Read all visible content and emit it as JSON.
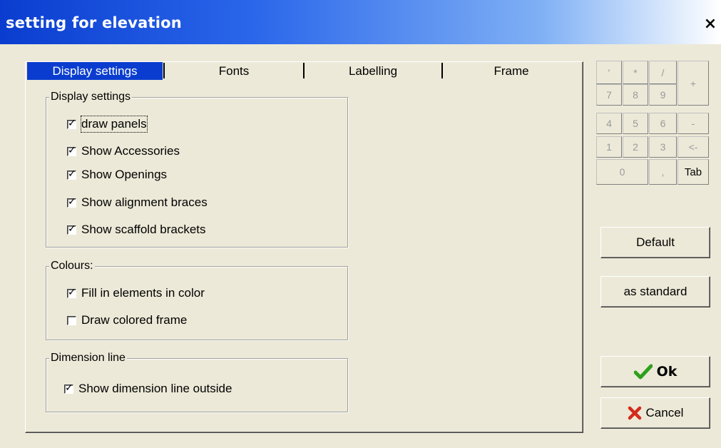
{
  "window": {
    "title": "setting for elevation",
    "close_symbol": "×"
  },
  "tabs": [
    {
      "label": "Display settings",
      "active": true
    },
    {
      "label": "Fonts",
      "active": false
    },
    {
      "label": "Labelling",
      "active": false
    },
    {
      "label": "Frame",
      "active": false
    }
  ],
  "groups": {
    "display": {
      "legend": "Display settings",
      "items": [
        {
          "label": "draw panels",
          "checked": true
        },
        {
          "label": "Show Accessories",
          "checked": true
        },
        {
          "label": "Show Openings",
          "checked": true
        },
        {
          "label": "Show alignment braces",
          "checked": true
        },
        {
          "label": "Show scaffold brackets",
          "checked": true
        }
      ]
    },
    "colours": {
      "legend": "Colours:",
      "items": [
        {
          "label": "Fill in elements in color",
          "checked": true
        },
        {
          "label": "Draw colored frame",
          "checked": false
        }
      ]
    },
    "dimension": {
      "legend": "Dimension line",
      "items": [
        {
          "label": "Show dimension line outside",
          "checked": true
        }
      ]
    }
  },
  "checkmark": "✓",
  "numpad": {
    "row1": [
      "'",
      "*",
      "/"
    ],
    "plus": "+",
    "row2": [
      "7",
      "8",
      "9"
    ],
    "row3": [
      "4",
      "5",
      "6",
      "-"
    ],
    "row4": [
      "1",
      "2",
      "3",
      "<-"
    ],
    "zero": "0",
    "comma": ",",
    "tab": "Tab"
  },
  "buttons": {
    "default": "Default",
    "as_standard": "as standard",
    "ok": "Ok",
    "cancel": "Cancel"
  },
  "icons": {
    "ok": "green-checkmark-icon",
    "cancel": "red-x-icon"
  },
  "colors": {
    "titlebar": "#0a3dcf",
    "active_tab": "#0a3dcf",
    "ok_check": "#2ea01c",
    "cancel_x": "#d42a1a"
  }
}
